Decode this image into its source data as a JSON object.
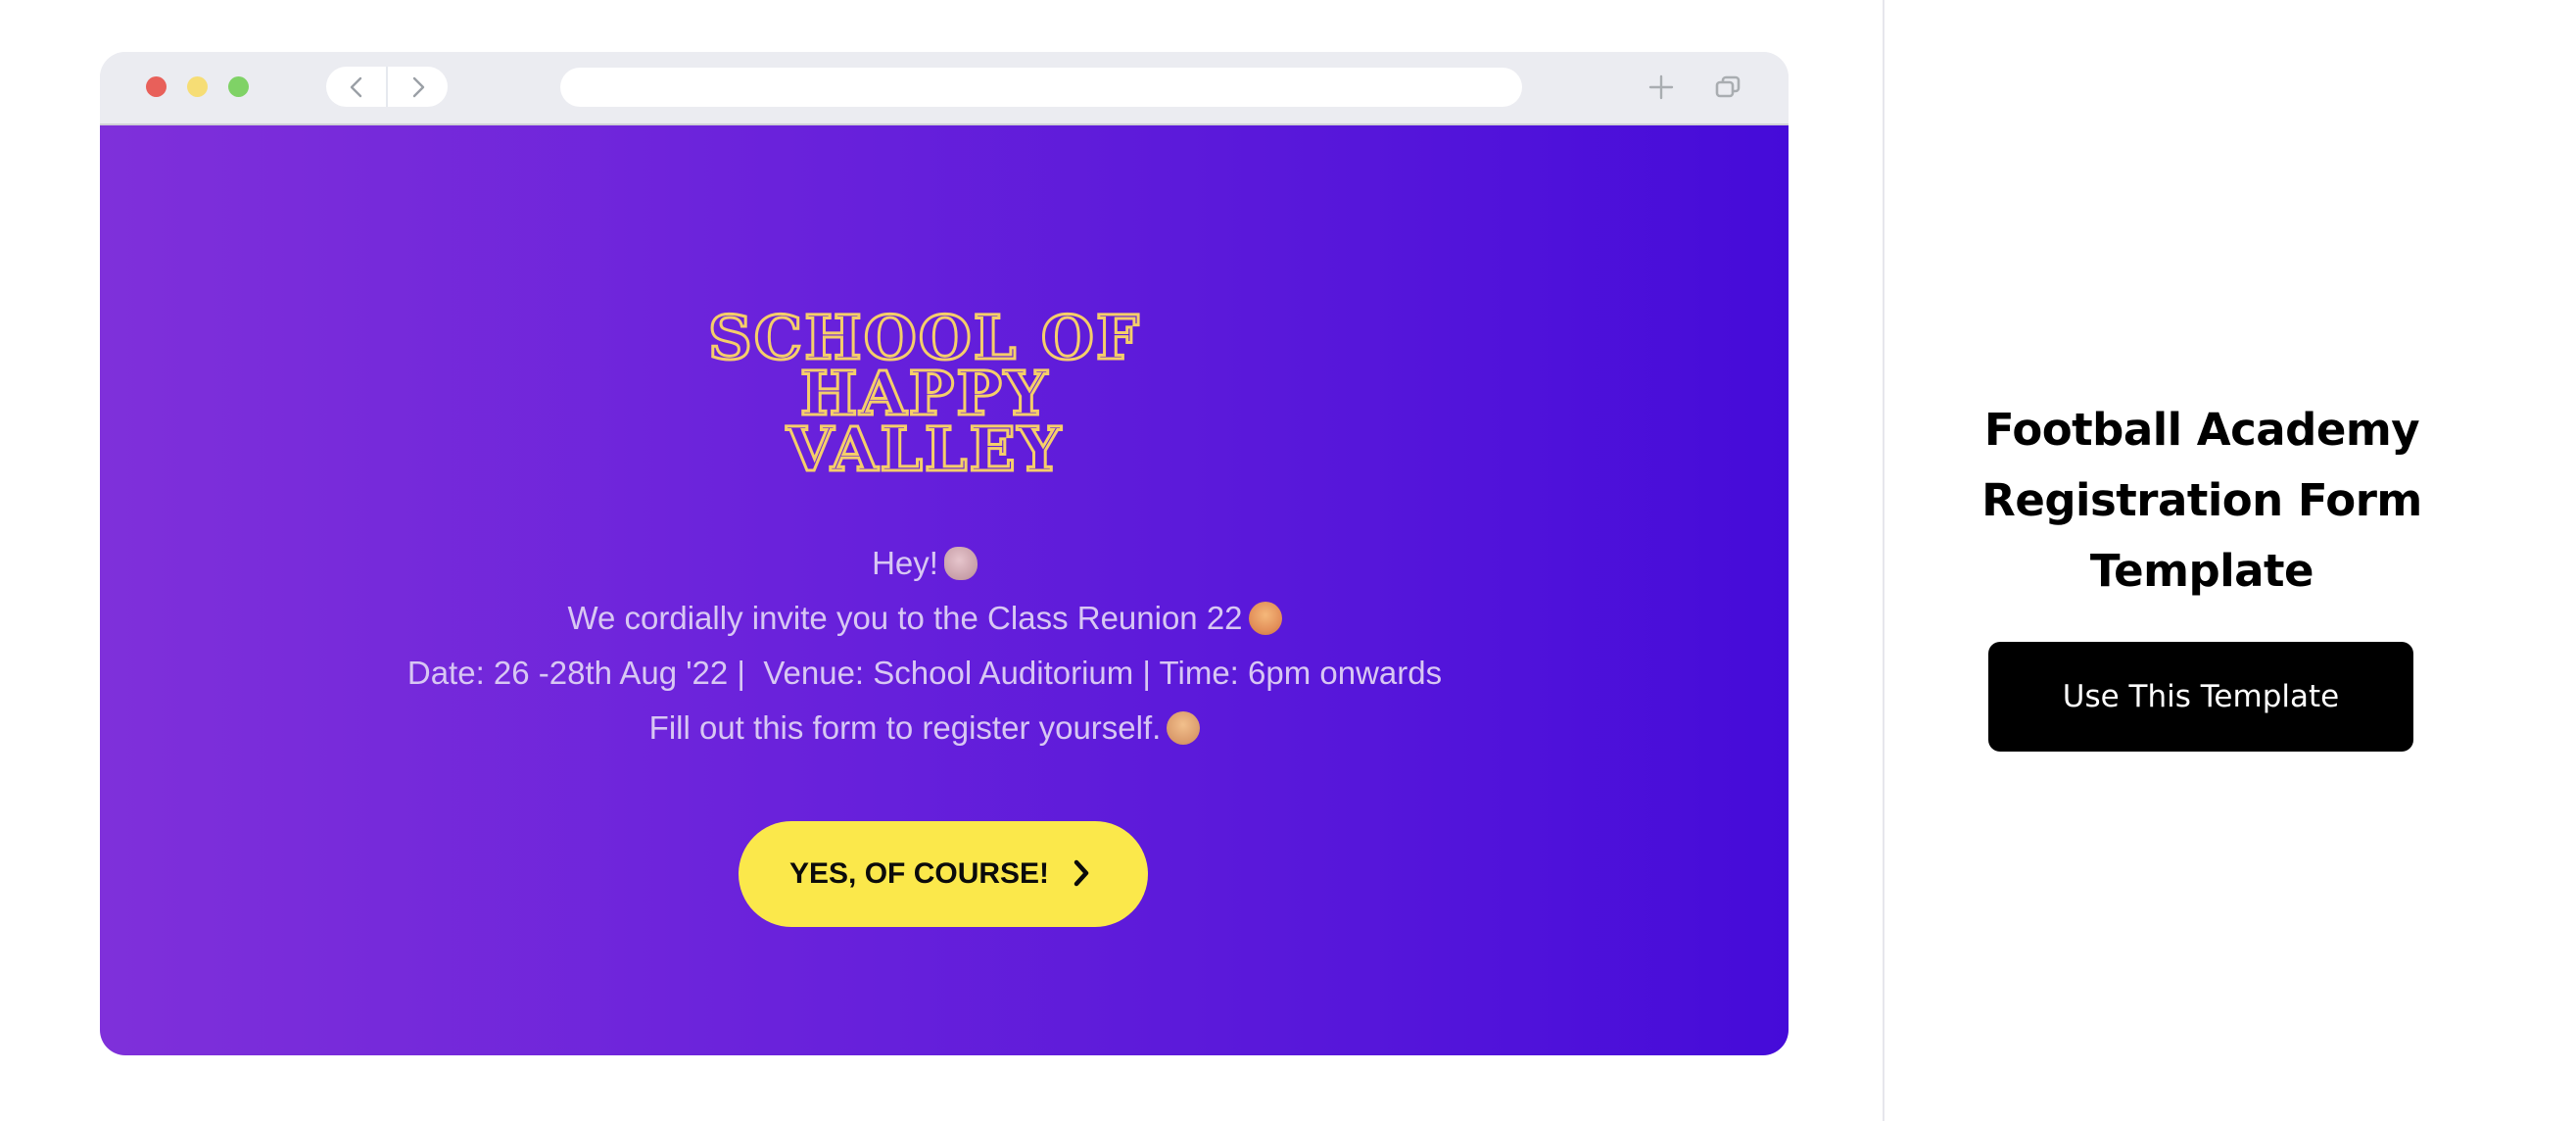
{
  "browser": {
    "window_controls": [
      {
        "name": "close",
        "color": "#e8605a"
      },
      {
        "name": "minimize",
        "color": "#f6dd75"
      },
      {
        "name": "maximize",
        "color": "#7fd266"
      }
    ],
    "nav": {
      "back_icon": "chevron-left-icon",
      "forward_icon": "chevron-right-icon"
    },
    "address_bar": {
      "value": "",
      "placeholder": ""
    },
    "actions": {
      "new_tab_icon": "plus-icon",
      "tabs_icon": "tabs-overview-icon"
    }
  },
  "form_preview": {
    "logo_lines": [
      "SCHOOL OF",
      "HAPPY",
      "VALLEY"
    ],
    "logo_color": "#f5ce6a",
    "background_gradient": [
      "#7f30da",
      "#450bd9"
    ],
    "message_lines": [
      {
        "text": "Hey!",
        "emoji": "waving-hand"
      },
      {
        "text": "We cordially invite you to the Class Reunion 22",
        "emoji": "hugging-face"
      },
      {
        "text": "Date: 26 -28th Aug '22 |  Venue: School Auditorium | Time: 6pm onwards",
        "emoji": null
      },
      {
        "text": "Fill out this form to register yourself.",
        "emoji": "slightly-smiling-face"
      }
    ],
    "cta": {
      "label": "YES, OF COURSE!",
      "icon": "chevron-right-icon",
      "color": "#fbe84b"
    }
  },
  "sidebar": {
    "title": "Football Academy Registration Form Template",
    "title_lines": [
      "Football Academy",
      "Registration Form",
      "Template"
    ],
    "button_label": "Use This Template"
  }
}
